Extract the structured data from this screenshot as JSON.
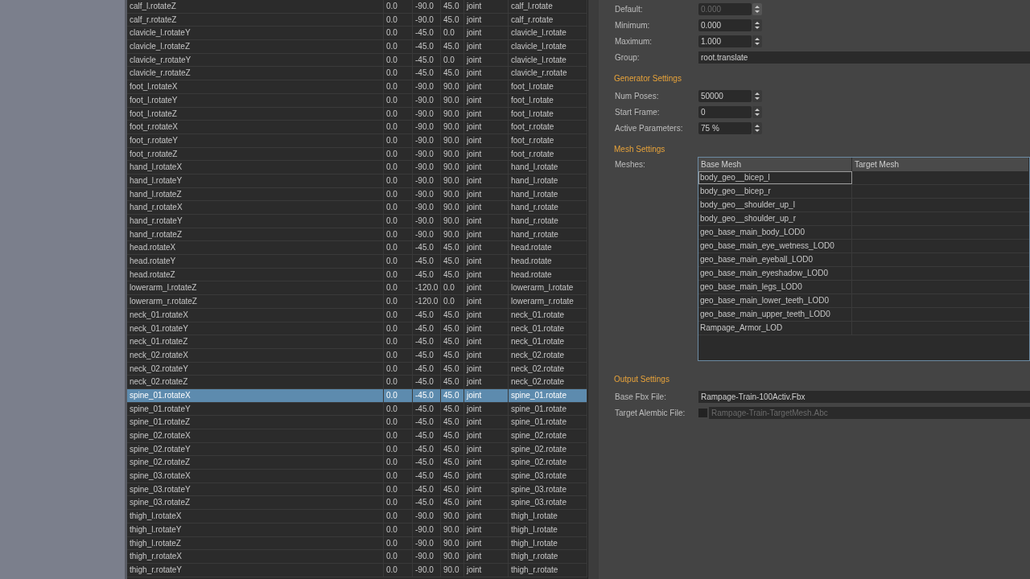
{
  "joint_table": {
    "rows": [
      {
        "cells": [
          "calf_l.rotateZ",
          "0.0",
          "-90.0",
          "45.0",
          "joint",
          "calf_l.rotate"
        ],
        "selected": false
      },
      {
        "cells": [
          "calf_r.rotateZ",
          "0.0",
          "-90.0",
          "45.0",
          "joint",
          "calf_r.rotate"
        ],
        "selected": false
      },
      {
        "cells": [
          "clavicle_l.rotateY",
          "0.0",
          "-45.0",
          "0.0",
          "joint",
          "clavicle_l.rotate"
        ],
        "selected": false
      },
      {
        "cells": [
          "clavicle_l.rotateZ",
          "0.0",
          "-45.0",
          "45.0",
          "joint",
          "clavicle_l.rotate"
        ],
        "selected": false
      },
      {
        "cells": [
          "clavicle_r.rotateY",
          "0.0",
          "-45.0",
          "0.0",
          "joint",
          "clavicle_l.rotate"
        ],
        "selected": false
      },
      {
        "cells": [
          "clavicle_r.rotateZ",
          "0.0",
          "-45.0",
          "45.0",
          "joint",
          "clavicle_r.rotate"
        ],
        "selected": false
      },
      {
        "cells": [
          "foot_l.rotateX",
          "0.0",
          "-90.0",
          "90.0",
          "joint",
          "foot_l.rotate"
        ],
        "selected": false
      },
      {
        "cells": [
          "foot_l.rotateY",
          "0.0",
          "-90.0",
          "90.0",
          "joint",
          "foot_l.rotate"
        ],
        "selected": false
      },
      {
        "cells": [
          "foot_l.rotateZ",
          "0.0",
          "-90.0",
          "90.0",
          "joint",
          "foot_l.rotate"
        ],
        "selected": false
      },
      {
        "cells": [
          "foot_r.rotateX",
          "0.0",
          "-90.0",
          "90.0",
          "joint",
          "foot_r.rotate"
        ],
        "selected": false
      },
      {
        "cells": [
          "foot_r.rotateY",
          "0.0",
          "-90.0",
          "90.0",
          "joint",
          "foot_r.rotate"
        ],
        "selected": false
      },
      {
        "cells": [
          "foot_r.rotateZ",
          "0.0",
          "-90.0",
          "90.0",
          "joint",
          "foot_r.rotate"
        ],
        "selected": false
      },
      {
        "cells": [
          "hand_l.rotateX",
          "0.0",
          "-90.0",
          "90.0",
          "joint",
          "hand_l.rotate"
        ],
        "selected": false
      },
      {
        "cells": [
          "hand_l.rotateY",
          "0.0",
          "-90.0",
          "90.0",
          "joint",
          "hand_l.rotate"
        ],
        "selected": false
      },
      {
        "cells": [
          "hand_l.rotateZ",
          "0.0",
          "-90.0",
          "90.0",
          "joint",
          "hand_l.rotate"
        ],
        "selected": false
      },
      {
        "cells": [
          "hand_r.rotateX",
          "0.0",
          "-90.0",
          "90.0",
          "joint",
          "hand_r.rotate"
        ],
        "selected": false
      },
      {
        "cells": [
          "hand_r.rotateY",
          "0.0",
          "-90.0",
          "90.0",
          "joint",
          "hand_r.rotate"
        ],
        "selected": false
      },
      {
        "cells": [
          "hand_r.rotateZ",
          "0.0",
          "-90.0",
          "90.0",
          "joint",
          "hand_r.rotate"
        ],
        "selected": false
      },
      {
        "cells": [
          "head.rotateX",
          "0.0",
          "-45.0",
          "45.0",
          "joint",
          "head.rotate"
        ],
        "selected": false
      },
      {
        "cells": [
          "head.rotateY",
          "0.0",
          "-45.0",
          "45.0",
          "joint",
          "head.rotate"
        ],
        "selected": false
      },
      {
        "cells": [
          "head.rotateZ",
          "0.0",
          "-45.0",
          "45.0",
          "joint",
          "head.rotate"
        ],
        "selected": false
      },
      {
        "cells": [
          "lowerarm_l.rotateZ",
          "0.0",
          "-120.0",
          "0.0",
          "joint",
          "lowerarm_l.rotate"
        ],
        "selected": false
      },
      {
        "cells": [
          "lowerarm_r.rotateZ",
          "0.0",
          "-120.0",
          "0.0",
          "joint",
          "lowerarm_r.rotate"
        ],
        "selected": false
      },
      {
        "cells": [
          "neck_01.rotateX",
          "0.0",
          "-45.0",
          "45.0",
          "joint",
          "neck_01.rotate"
        ],
        "selected": false
      },
      {
        "cells": [
          "neck_01.rotateY",
          "0.0",
          "-45.0",
          "45.0",
          "joint",
          "neck_01.rotate"
        ],
        "selected": false
      },
      {
        "cells": [
          "neck_01.rotateZ",
          "0.0",
          "-45.0",
          "45.0",
          "joint",
          "neck_01.rotate"
        ],
        "selected": false
      },
      {
        "cells": [
          "neck_02.rotateX",
          "0.0",
          "-45.0",
          "45.0",
          "joint",
          "neck_02.rotate"
        ],
        "selected": false
      },
      {
        "cells": [
          "neck_02.rotateY",
          "0.0",
          "-45.0",
          "45.0",
          "joint",
          "neck_02.rotate"
        ],
        "selected": false
      },
      {
        "cells": [
          "neck_02.rotateZ",
          "0.0",
          "-45.0",
          "45.0",
          "joint",
          "neck_02.rotate"
        ],
        "selected": false
      },
      {
        "cells": [
          "spine_01.rotateX",
          "0.0",
          "-45.0",
          "45.0",
          "joint",
          "spine_01.rotate"
        ],
        "selected": true
      },
      {
        "cells": [
          "spine_01.rotateY",
          "0.0",
          "-45.0",
          "45.0",
          "joint",
          "spine_01.rotate"
        ],
        "selected": false
      },
      {
        "cells": [
          "spine_01.rotateZ",
          "0.0",
          "-45.0",
          "45.0",
          "joint",
          "spine_01.rotate"
        ],
        "selected": false
      },
      {
        "cells": [
          "spine_02.rotateX",
          "0.0",
          "-45.0",
          "45.0",
          "joint",
          "spine_02.rotate"
        ],
        "selected": false
      },
      {
        "cells": [
          "spine_02.rotateY",
          "0.0",
          "-45.0",
          "45.0",
          "joint",
          "spine_02.rotate"
        ],
        "selected": false
      },
      {
        "cells": [
          "spine_02.rotateZ",
          "0.0",
          "-45.0",
          "45.0",
          "joint",
          "spine_02.rotate"
        ],
        "selected": false
      },
      {
        "cells": [
          "spine_03.rotateX",
          "0.0",
          "-45.0",
          "45.0",
          "joint",
          "spine_03.rotate"
        ],
        "selected": false
      },
      {
        "cells": [
          "spine_03.rotateY",
          "0.0",
          "-45.0",
          "45.0",
          "joint",
          "spine_03.rotate"
        ],
        "selected": false
      },
      {
        "cells": [
          "spine_03.rotateZ",
          "0.0",
          "-45.0",
          "45.0",
          "joint",
          "spine_03.rotate"
        ],
        "selected": false
      },
      {
        "cells": [
          "thigh_l.rotateX",
          "0.0",
          "-90.0",
          "90.0",
          "joint",
          "thigh_l.rotate"
        ],
        "selected": false
      },
      {
        "cells": [
          "thigh_l.rotateY",
          "0.0",
          "-90.0",
          "90.0",
          "joint",
          "thigh_l.rotate"
        ],
        "selected": false
      },
      {
        "cells": [
          "thigh_l.rotateZ",
          "0.0",
          "-90.0",
          "90.0",
          "joint",
          "thigh_l.rotate"
        ],
        "selected": false
      },
      {
        "cells": [
          "thigh_r.rotateX",
          "0.0",
          "-90.0",
          "90.0",
          "joint",
          "thigh_r.rotate"
        ],
        "selected": false
      },
      {
        "cells": [
          "thigh_r.rotateY",
          "0.0",
          "-90.0",
          "90.0",
          "joint",
          "thigh_r.rotate"
        ],
        "selected": false
      }
    ]
  },
  "parameter_fields": [
    {
      "kind": "spin",
      "label": "Default:",
      "value": "0.000",
      "disabled": true
    },
    {
      "kind": "spin",
      "label": "Minimum:",
      "value": "0.000",
      "disabled": false
    },
    {
      "kind": "spin",
      "label": "Maximum:",
      "value": "1.000",
      "disabled": false
    },
    {
      "kind": "text",
      "label": "Group:",
      "value": "root.translate",
      "disabled": false
    }
  ],
  "generator_settings": {
    "title": "Generator Settings",
    "fields": [
      {
        "kind": "spin",
        "label": "Num Poses:",
        "value": "50000",
        "disabled": false
      },
      {
        "kind": "spin",
        "label": "Start Frame:",
        "value": "0",
        "disabled": false
      },
      {
        "kind": "spin",
        "label": "Active Parameters:",
        "value": "75 %",
        "disabled": false
      }
    ]
  },
  "mesh_settings": {
    "title": "Mesh Settings",
    "label": "Meshes:",
    "columns": [
      "Base Mesh",
      "Target Mesh"
    ],
    "rows": [
      {
        "base_mesh": "body_geo__bicep_l",
        "selected": true
      },
      {
        "base_mesh": "body_geo__bicep_r",
        "selected": false
      },
      {
        "base_mesh": "body_geo__shoulder_up_l",
        "selected": false
      },
      {
        "base_mesh": "body_geo__shoulder_up_r",
        "selected": false
      },
      {
        "base_mesh": "geo_base_main_body_LOD0",
        "selected": false
      },
      {
        "base_mesh": "geo_base_main_eye_wetness_LOD0",
        "selected": false
      },
      {
        "base_mesh": "geo_base_main_eyeball_LOD0",
        "selected": false
      },
      {
        "base_mesh": "geo_base_main_eyeshadow_LOD0",
        "selected": false
      },
      {
        "base_mesh": "geo_base_main_legs_LOD0",
        "selected": false
      },
      {
        "base_mesh": "geo_base_main_lower_teeth_LOD0",
        "selected": false
      },
      {
        "base_mesh": "geo_base_main_upper_teeth_LOD0",
        "selected": false
      },
      {
        "base_mesh": "Rampage_Armor_LOD",
        "selected": false
      }
    ]
  },
  "output_settings": {
    "title": "Output Settings",
    "base_fbx": {
      "label": "Base Fbx File:",
      "value": "Rampage-Train-100Activ.Fbx"
    },
    "target_alembic": {
      "label": "Target Alembic File:",
      "checked": false,
      "value": "Rampage-Train-TargetMesh.Abc"
    }
  }
}
